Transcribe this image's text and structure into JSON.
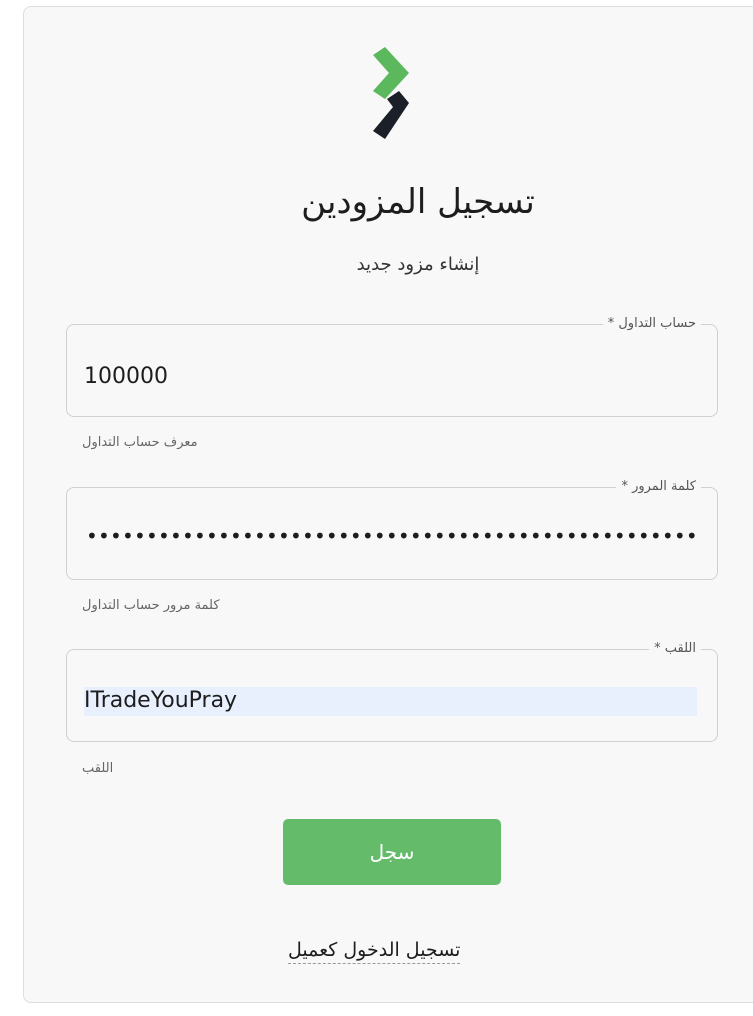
{
  "header": {
    "title": "تسجيل المزودين",
    "subtitle": "إنشاء مزود جديد"
  },
  "logo": {
    "icon": "chevron-logo-icon",
    "colors": {
      "green": "#5cb85c",
      "dark": "#1b1f27"
    }
  },
  "fields": {
    "trading_account": {
      "label": "حساب التداول *",
      "value": "100000",
      "helper": "معرف حساب التداول"
    },
    "password": {
      "label": "كلمة المرور *",
      "value": "••••••••••••••••••••••••••••••••••••••••••••••••••••••••••",
      "helper": "كلمة مرور حساب التداول"
    },
    "nickname": {
      "label": "اللقب *",
      "value": "ITradeYouPray",
      "helper": "اللقب"
    }
  },
  "actions": {
    "submit_label": "سجل",
    "login_link": "تسجيل الدخول كعميل"
  },
  "colors": {
    "accent": "#64bb6a",
    "autofill": "#e8f0fe"
  }
}
